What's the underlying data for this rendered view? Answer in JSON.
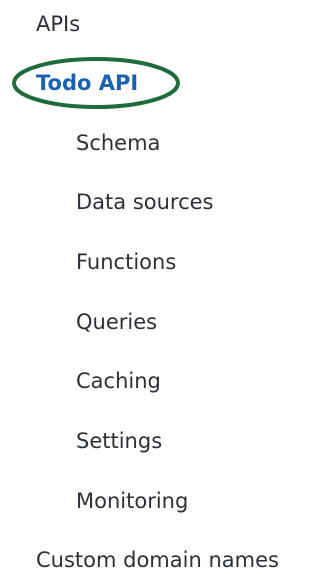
{
  "nav": {
    "apis_label": "APIs",
    "active_api_label": "Todo API",
    "sub_items": [
      "Schema",
      "Data sources",
      "Functions",
      "Queries",
      "Caching",
      "Settings",
      "Monitoring"
    ],
    "custom_domains_label": "Custom domain names"
  },
  "colors": {
    "text": "#2b3136",
    "active": "#1a62b0",
    "highlight_ring": "#1f6b3a"
  }
}
